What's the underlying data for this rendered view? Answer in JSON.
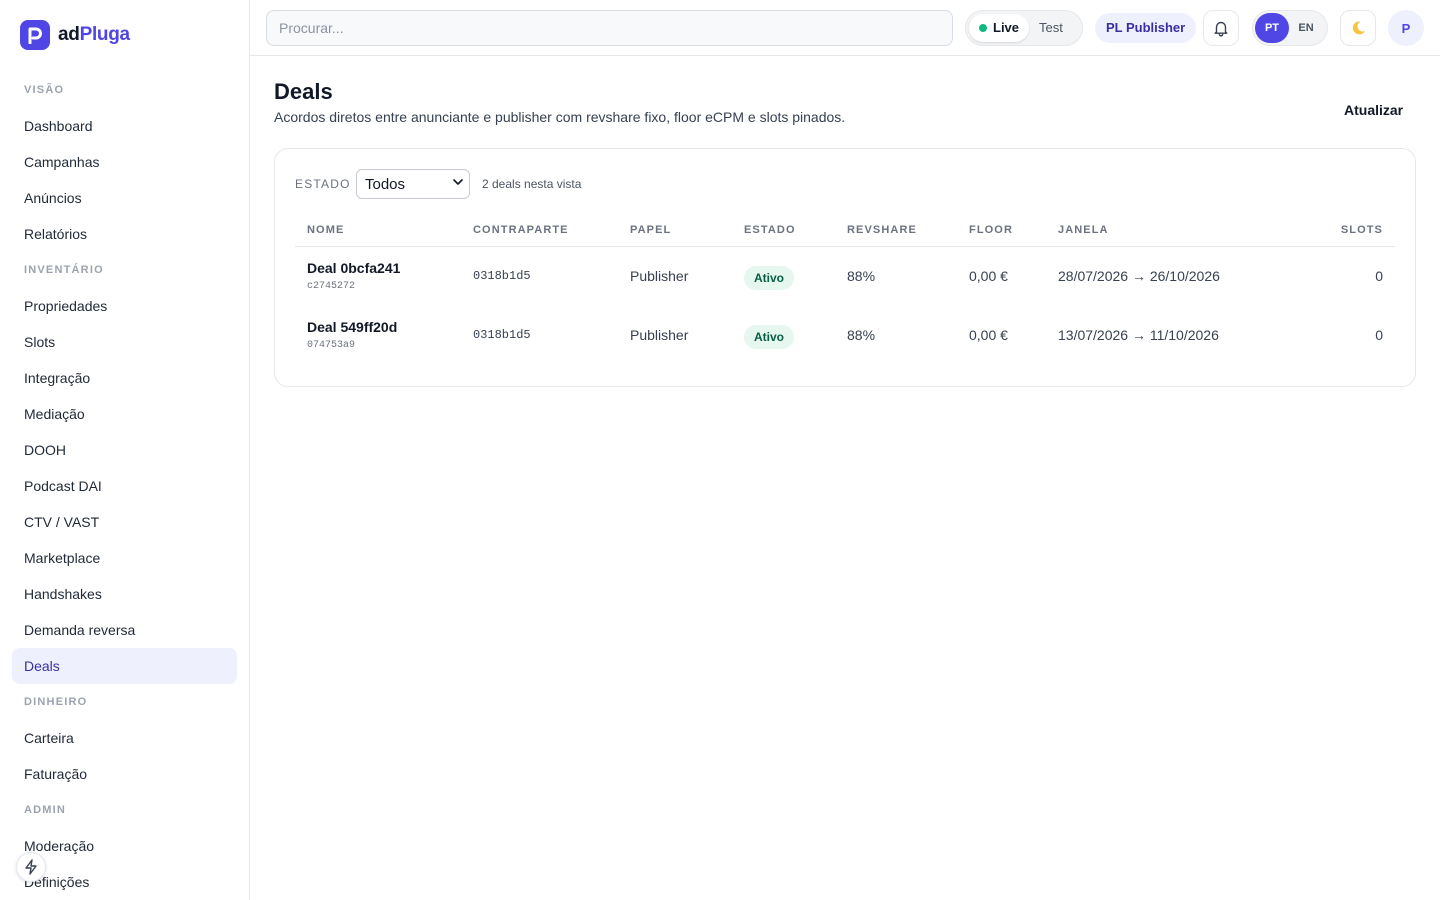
{
  "brand": {
    "name_part1": "ad",
    "name_part2": "Pluga"
  },
  "sidebar": {
    "sections": [
      {
        "label": "VISÃO",
        "items": [
          "Dashboard",
          "Campanhas",
          "Anúncios",
          "Relatórios"
        ]
      },
      {
        "label": "INVENTÁRIO",
        "items": [
          "Propriedades",
          "Slots",
          "Integração",
          "Mediação",
          "DOOH",
          "Podcast DAI",
          "CTV / VAST",
          "Marketplace",
          "Handshakes",
          "Demanda reversa",
          "Deals"
        ]
      },
      {
        "label": "DINHEIRO",
        "items": [
          "Carteira",
          "Faturação"
        ]
      },
      {
        "label": "ADMIN",
        "items": [
          "Moderação",
          "Definições"
        ]
      }
    ],
    "active_item": "Deals"
  },
  "topbar": {
    "search_placeholder": "Procurar...",
    "mode_live": "Live",
    "mode_test": "Test",
    "role_label": "PL Publisher",
    "lang_pt": "PT",
    "lang_en": "EN",
    "avatar_initial": "P"
  },
  "page": {
    "title": "Deals",
    "subtitle": "Acordos diretos entre anunciante e publisher com revshare fixo, floor eCPM e slots pinados.",
    "refresh_label": "Atualizar"
  },
  "filter": {
    "label": "ESTADO",
    "selected": "Todos",
    "count_text": "2 deals nesta vista"
  },
  "table": {
    "headers": [
      "NOME",
      "CONTRAPARTE",
      "PAPEL",
      "ESTADO",
      "REVSHARE",
      "FLOOR",
      "JANELA",
      "SLOTS"
    ],
    "rows": [
      {
        "name": "Deal 0bcfa241",
        "id": "c2745272",
        "counterparty": "0318b1d5",
        "role": "Publisher",
        "status": "Ativo",
        "revshare": "88%",
        "floor": "0,00 €",
        "window": "28/07/2026 → 26/10/2026",
        "slots": "0"
      },
      {
        "name": "Deal 549ff20d",
        "id": "074753a9",
        "counterparty": "0318b1d5",
        "role": "Publisher",
        "status": "Ativo",
        "revshare": "88%",
        "floor": "0,00 €",
        "window": "13/07/2026 → 11/10/2026",
        "slots": "0"
      }
    ]
  },
  "colors": {
    "accent": "#4f46e5",
    "live_dot": "#10b981",
    "active_nav_bg": "#eef0fd",
    "status_badge_bg": "#e6f7ef"
  }
}
